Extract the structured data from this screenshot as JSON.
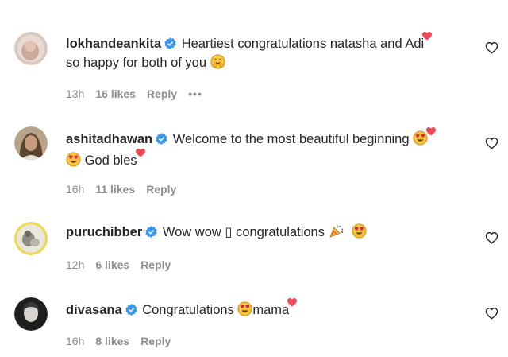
{
  "comments": [
    {
      "username": "lokhandeankita",
      "text_part1": "Heartiest congratulations natasha and Adi",
      "text_part2": "so happy for both of you",
      "time": "13h",
      "likes": "16 likes",
      "reply": "Reply",
      "more": "•••"
    },
    {
      "username": "ashitadhawan",
      "text_part1": "Welcome to the most beautiful beginning",
      "text_part2": "God bles",
      "time": "16h",
      "likes": "11 likes",
      "reply": "Reply"
    },
    {
      "username": "puruchibber",
      "text_part1": "Wow wow ▯ congratulations",
      "time": "12h",
      "likes": "6 likes",
      "reply": "Reply"
    },
    {
      "username": "divasana",
      "text_part1": "Congratulations",
      "text_part2": "mama",
      "time": "16h",
      "likes": "8 likes",
      "reply": "Reply"
    }
  ],
  "colors": {
    "verified": "#3897f0",
    "secondary_text": "#8e8e8e",
    "heart_red": "#ed4956",
    "emoji_yellow": "#f9c33a"
  },
  "icons": [
    "verified-badge-icon",
    "heart-outline-icon",
    "heart-eyes-emoji-icon",
    "hugging-face-emoji-icon",
    "party-popper-emoji-icon",
    "red-heart-emoji-icon"
  ]
}
